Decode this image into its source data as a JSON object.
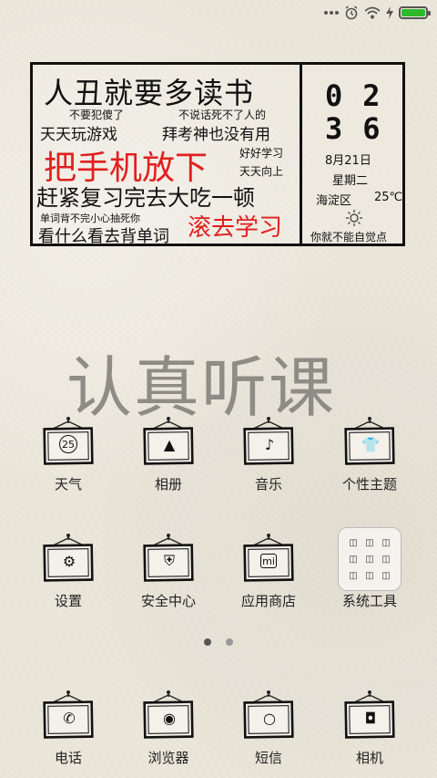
{
  "status": {
    "icons": [
      "dots-icon",
      "alarm-icon",
      "wifi-icon",
      "charging-icon",
      "battery-icon"
    ],
    "battery_level": 1.0,
    "battery_color": "#2dbb2d"
  },
  "widget": {
    "title": "人丑就要多读书",
    "line1_a": "不要犯傻了",
    "line1_b": "不说话死不了人的",
    "line2_a": "天天玩游戏",
    "line2_b": "拜考神也没有用",
    "big_red": "把手机放下",
    "side1": "好好学习",
    "side2": "天天向上",
    "line3": "赶紧复习完去大吃一顿",
    "small_line": "单词背不完小心抽死你",
    "line4": "看什么看去背单词",
    "red_end": "滚去学习",
    "accent_red": "#e0201f"
  },
  "clock": {
    "hour": "02",
    "minute": "36",
    "date": "8月21日",
    "weekday": "星期二",
    "location": "海淀区",
    "temperature": "25℃",
    "weather_icon": "sun-icon",
    "slogan": "你就不能自觉点"
  },
  "watermark": "认真听课",
  "apps_row1": [
    {
      "label": "天气",
      "icon": "weather-icon",
      "glyph": "25"
    },
    {
      "label": "相册",
      "icon": "gallery-icon",
      "glyph": "▲"
    },
    {
      "label": "音乐",
      "icon": "music-icon",
      "glyph": "♪"
    },
    {
      "label": "个性主题",
      "icon": "theme-icon",
      "glyph": "👕"
    }
  ],
  "apps_row2": [
    {
      "label": "设置",
      "icon": "settings-icon",
      "glyph": "⚙"
    },
    {
      "label": "安全中心",
      "icon": "shield-icon",
      "glyph": "⛨"
    },
    {
      "label": "应用商店",
      "icon": "store-icon",
      "glyph": "mi"
    },
    {
      "label": "系统工具",
      "icon": "tools-folder-icon",
      "glyph": ""
    }
  ],
  "dock": [
    {
      "label": "电话",
      "icon": "phone-icon",
      "glyph": "✆"
    },
    {
      "label": "浏览器",
      "icon": "browser-icon",
      "glyph": "◉"
    },
    {
      "label": "短信",
      "icon": "message-icon",
      "glyph": "○"
    },
    {
      "label": "相机",
      "icon": "camera-icon",
      "glyph": "◘"
    }
  ],
  "pager": {
    "pages": 2,
    "current": 1
  }
}
